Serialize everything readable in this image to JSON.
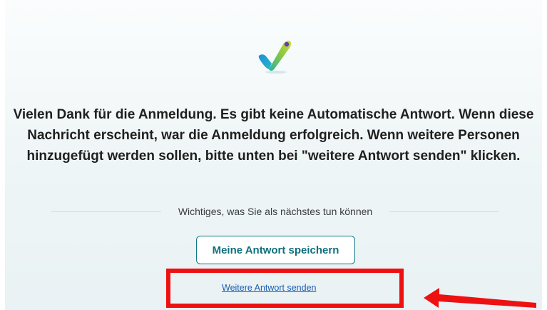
{
  "confirmation": {
    "icon": "checkmark-icon",
    "message": "Vielen Dank für die Anmeldung. Es gibt keine Automatische Antwort. Wenn diese Nachricht erscheint, war die Anmeldung erfolgreich. Wenn weitere Personen hinzugefügt werden sollen, bitte unten bei \"weitere Antwort senden\" klicken.",
    "next_steps_heading": "Wichtiges, was Sie als nächstes tun können",
    "save_button_label": "Meine Antwort speichern",
    "send_another_link": "Weitere Antwort senden"
  },
  "annotation": {
    "color": "#ee1111",
    "highlight": "highlight-box",
    "pointer": "arrow-icon"
  },
  "colors": {
    "accent": "#0f7a8a",
    "link": "#1a5fb4",
    "text": "#1f1f1f"
  }
}
